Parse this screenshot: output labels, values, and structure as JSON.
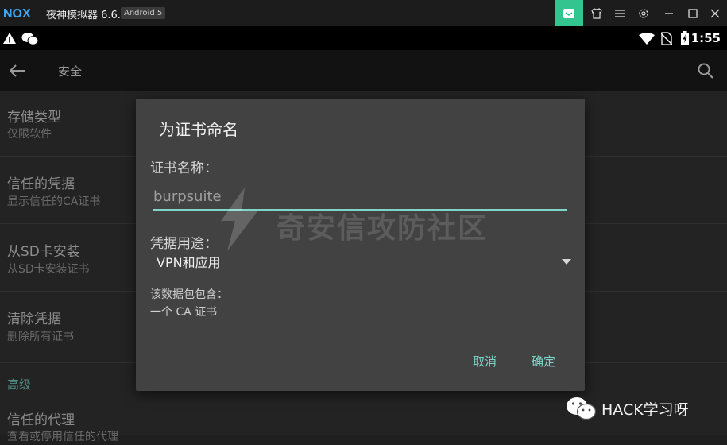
{
  "emulator": {
    "logo_text": "NOX",
    "title": "夜神模拟器 6.6.1.1",
    "android_badge": "Android 5",
    "buttons": [
      "mail-icon",
      "shirt-icon",
      "menu-icon",
      "gear-icon",
      "minimize-icon",
      "maximize-icon",
      "close-icon"
    ],
    "accent": "#33c48f"
  },
  "statusbar": {
    "left_icons": [
      "warning-icon",
      "wechat-icon"
    ],
    "right_icons": [
      "wifi-icon",
      "no-sim-icon",
      "battery-charging-icon"
    ],
    "time": "1:55"
  },
  "appbar": {
    "title": "安全",
    "back_icon": "arrow-left-icon",
    "search_icon": "search-icon"
  },
  "settings": {
    "items": [
      {
        "title": "存储类型",
        "subtitle": "仅限软件"
      },
      {
        "title": "信任的凭据",
        "subtitle": "显示信任的CA证书"
      },
      {
        "title": "从SD卡安装",
        "subtitle": "从SD卡安装证书"
      },
      {
        "title": "清除凭据",
        "subtitle": "删除所有证书"
      }
    ],
    "section_header": "高级",
    "trusted_agents": {
      "title": "信任的代理",
      "subtitle": "查看或停用信任的代理"
    }
  },
  "dialog": {
    "title": "为证书命名",
    "name_label": "证书名称：",
    "name_value": "burpsuite",
    "usage_label": "凭据用途：",
    "usage_value": "VPN和应用",
    "package_label": "该数据包包含：",
    "package_contents": "一个 CA 证书",
    "cancel_label": "取消",
    "ok_label": "确定",
    "accent": "#7fd6c8"
  },
  "watermarks": {
    "center_text": "奇安信攻防社区",
    "wechat_text": "HACK学习呀"
  }
}
